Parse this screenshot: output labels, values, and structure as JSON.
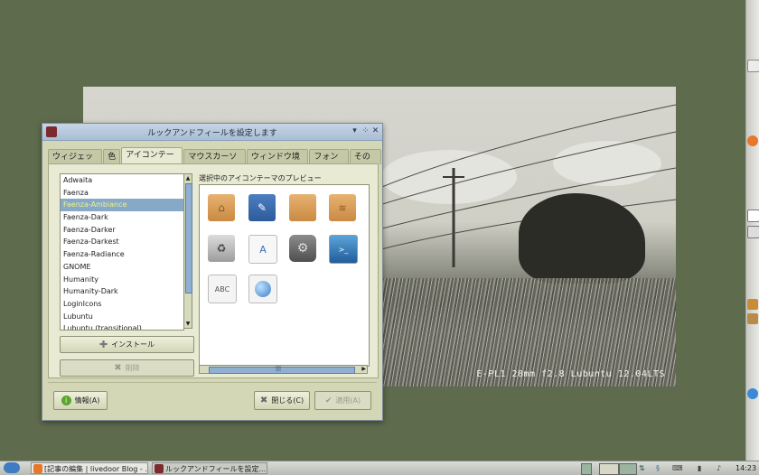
{
  "wallpaper": {
    "caption": "E-PL1 28mm f2.8   Lubuntu 12.04LTS"
  },
  "dialog": {
    "title": "ルックアンドフィールを設定します",
    "tabs": [
      "ウィジェット",
      "色",
      "アイコンテーマ",
      "マウスカーソル",
      "ウィンドウ境界",
      "フォント",
      "その他"
    ],
    "active_tab": "アイコンテーマ",
    "themes": [
      "Adwaita",
      "Faenza",
      "Faenza-Ambiance",
      "Faenza-Dark",
      "Faenza-Darker",
      "Faenza-Darkest",
      "Faenza-Radiance",
      "GNOME",
      "Humanity",
      "Humanity-Dark",
      "LoginIcons",
      "Lubuntu",
      "Lubuntu (transitional)"
    ],
    "selected_theme": "Faenza-Ambiance",
    "install_label": "インストール",
    "delete_label": "削除",
    "preview_label": "選択中のアイコンテーマのプレビュー",
    "preview_icons": [
      "home-folder-icon",
      "desktop-icon",
      "folder-icon",
      "network-folder-icon",
      "trash-icon",
      "document-icon",
      "settings-icon",
      "terminal-icon",
      "text-file-icon",
      "globe-icon"
    ],
    "preview_icon_text": "ABC",
    "about_label": "情報(A)",
    "close_label": "閉じる(C)",
    "apply_label": "適用(A)"
  },
  "taskbar": {
    "tasks": [
      "[記事の編集 | livedoor Blog - ...",
      "ルックアンドフィールを設定..."
    ],
    "clock": "14:23"
  },
  "colors": {
    "accent": "#86a9c7",
    "selected_text": "#f2f28a",
    "dialog_bg": "#d4d7b5",
    "desktop": "#5e6b4d"
  }
}
